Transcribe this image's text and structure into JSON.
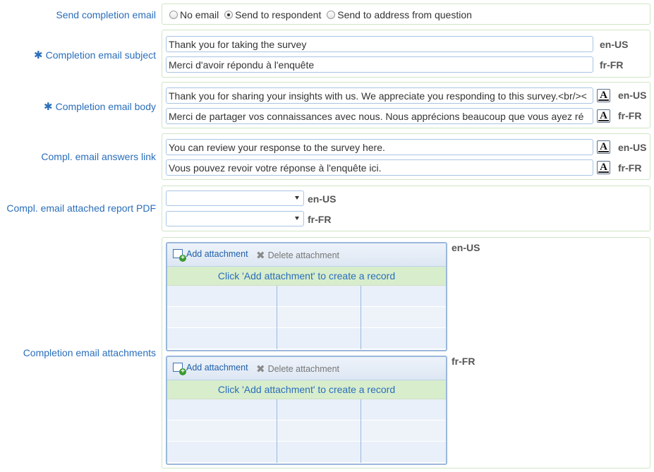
{
  "send_completion": {
    "label": "Send completion email",
    "options": [
      {
        "label": "No email",
        "selected": false
      },
      {
        "label": "Send to respondent",
        "selected": true
      },
      {
        "label": "Send to address from question",
        "selected": false
      }
    ]
  },
  "subject": {
    "label": "Completion email subject",
    "required_mark": "✱",
    "rows": [
      {
        "value": "Thank you for taking the survey",
        "lang": "en-US"
      },
      {
        "value": "Merci d'avoir répondu à l'enquête",
        "lang": "fr-FR"
      }
    ]
  },
  "body": {
    "label": "Completion email body",
    "required_mark": "✱",
    "format_icon": "A",
    "rows": [
      {
        "value": "Thank you for sharing your insights with us. We appreciate you responding to this survey.<br/><",
        "lang": "en-US"
      },
      {
        "value": "Merci de partager vos connaissances avec nous. Nous apprécions beaucoup que vous ayez ré",
        "lang": "fr-FR"
      }
    ]
  },
  "answers_link": {
    "label": "Compl. email answers link",
    "format_icon": "A",
    "rows": [
      {
        "value": "You can review your response to the survey here.",
        "lang": "en-US"
      },
      {
        "value": "Vous pouvez revoir votre réponse à l'enquête ici.",
        "lang": "fr-FR"
      }
    ]
  },
  "report_pdf": {
    "label": "Compl. email attached report PDF",
    "rows": [
      {
        "value": "",
        "lang": "en-US"
      },
      {
        "value": "",
        "lang": "fr-FR"
      }
    ]
  },
  "attachments": {
    "label": "Completion email attachments",
    "grids": [
      {
        "lang": "en-US",
        "add_label": "Add attachment",
        "delete_label": "Delete attachment",
        "empty_message": "Click 'Add attachment' to create a record"
      },
      {
        "lang": "fr-FR",
        "add_label": "Add attachment",
        "delete_label": "Delete attachment",
        "empty_message": "Click 'Add attachment' to create a record"
      }
    ]
  },
  "colors": {
    "label_blue": "#2a6ebb",
    "panel_border": "#cfe5c4",
    "grid_border": "#9bb8dc",
    "empty_row_green": "#d8edcc"
  }
}
